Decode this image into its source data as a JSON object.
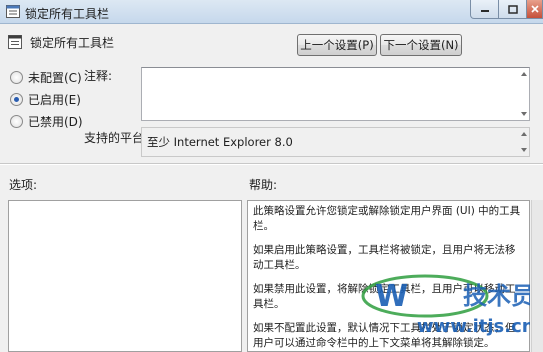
{
  "window": {
    "title": "锁定所有工具栏"
  },
  "header": {
    "policy_name": "锁定所有工具栏",
    "prev_button": "上一个设置(P)",
    "next_button": "下一个设置(N)"
  },
  "state_options": [
    {
      "label": "未配置(C)",
      "checked": false
    },
    {
      "label": "已启用(E)",
      "checked": true
    },
    {
      "label": "已禁用(D)",
      "checked": false
    }
  ],
  "comment": {
    "label": "注释:",
    "value": ""
  },
  "platform": {
    "label": "支持的平台:",
    "value": "至少 Internet Explorer 8.0"
  },
  "options": {
    "label": "选项:"
  },
  "help": {
    "label": "帮助:",
    "paragraphs": [
      "此策略设置允许您锁定或解除锁定用户界面 (UI) 中的工具栏。",
      "如果启用此策略设置，工具栏将被锁定，且用户将无法移动工具栏。",
      "如果禁用此设置，将解除锁定工具栏，且用户可以移动工具栏。",
      "如果不配置此设置，默认情况下工具栏处于锁定状态，但用户可以通过命令栏中的上下文菜单将其解除锁定。"
    ]
  },
  "watermark": {
    "brand_text": "技术员联盟",
    "url": "www.itjs.cn"
  },
  "colors": {
    "titlebar": "#c6d8ec",
    "window_bg": "#f0f0f0",
    "accent": "#2a5db0",
    "watermark_blue": "#1a5fb4",
    "watermark_green": "#2e9e3e"
  }
}
